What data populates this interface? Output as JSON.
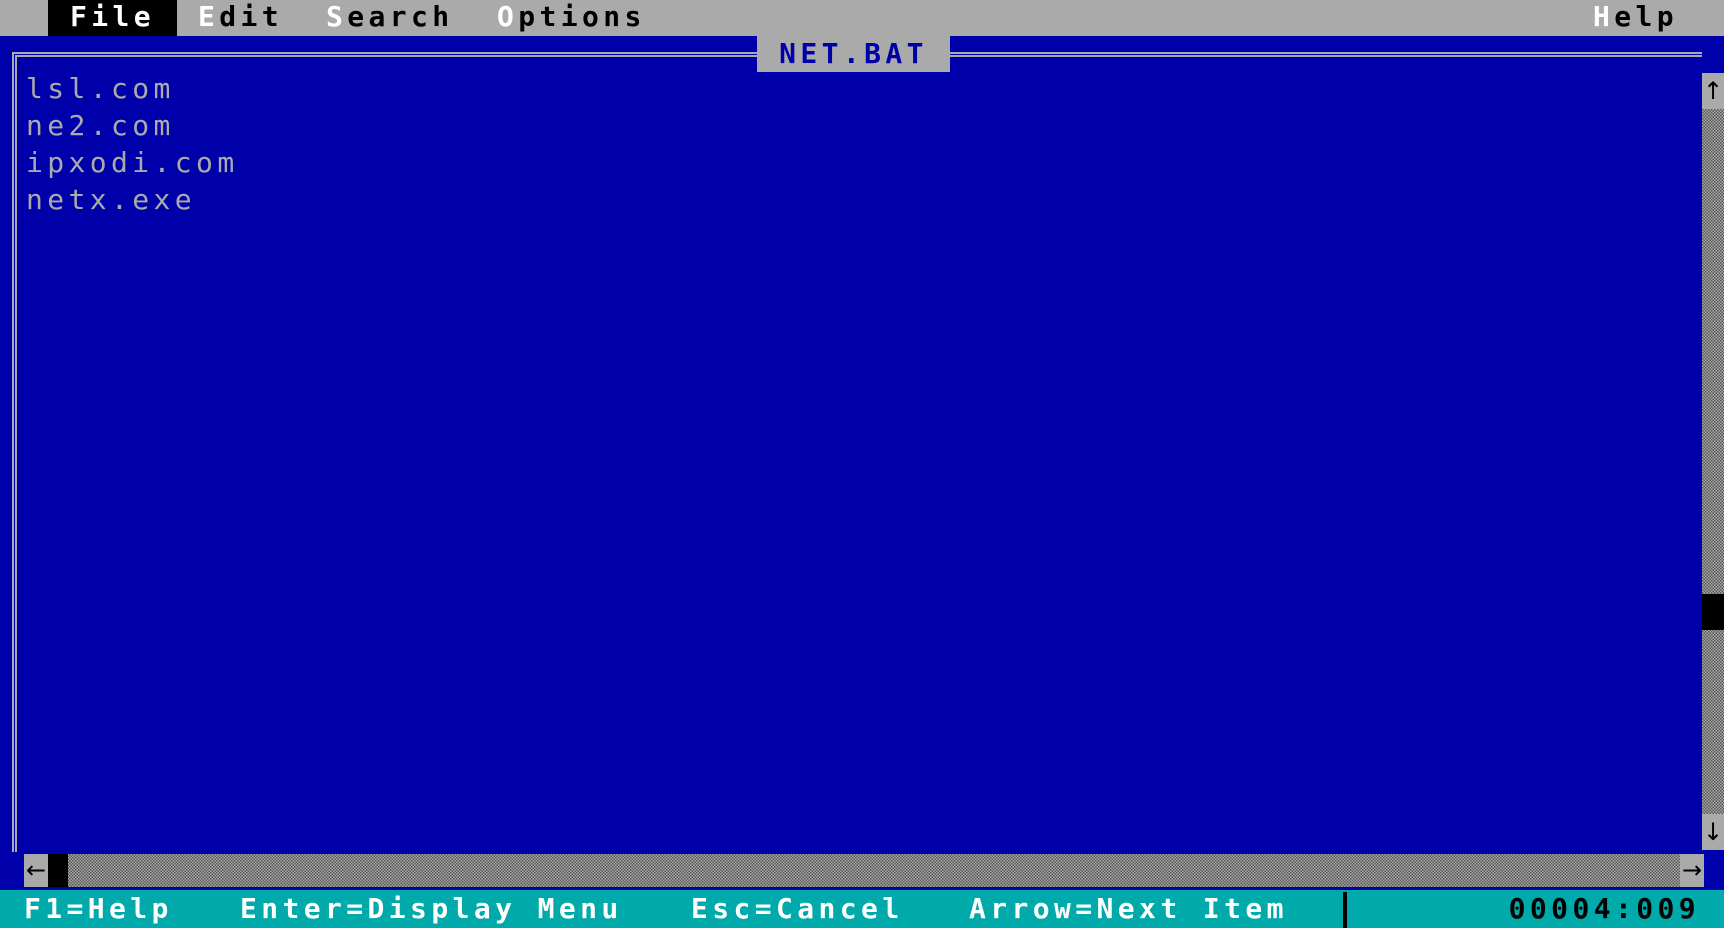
{
  "menubar": {
    "items": [
      {
        "hotkey": "F",
        "rest": "ile",
        "active": true
      },
      {
        "hotkey": "E",
        "rest": "dit",
        "active": false
      },
      {
        "hotkey": "S",
        "rest": "earch",
        "active": false
      },
      {
        "hotkey": "O",
        "rest": "ptions",
        "active": false
      }
    ],
    "help": {
      "hotkey": "H",
      "rest": "elp"
    }
  },
  "window": {
    "title": "NET.BAT",
    "lines": [
      "lsl.com",
      "ne2.com",
      "ipxodi.com",
      "netx.exe"
    ]
  },
  "scrollbars": {
    "up": "↑",
    "down": "↓",
    "left": "←",
    "right": "→"
  },
  "status": {
    "items": [
      "F1=Help",
      "Enter=Display Menu",
      "Esc=Cancel",
      "Arrow=Next Item"
    ],
    "position": "00004:009"
  },
  "colors": {
    "background": "#0000aa",
    "menubar": "#aaaaaa",
    "status": "#00aaaa"
  }
}
